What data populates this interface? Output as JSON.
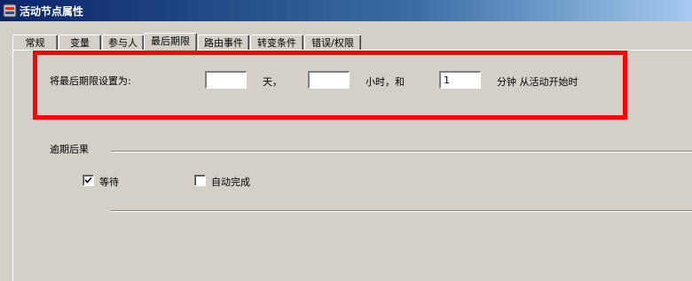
{
  "window": {
    "title": "活动节点属性"
  },
  "tabs": [
    {
      "label": "常规"
    },
    {
      "label": "变量"
    },
    {
      "label": "参与人"
    },
    {
      "label": "最后期限"
    },
    {
      "label": "路由事件"
    },
    {
      "label": "转变条件"
    },
    {
      "label": "错误/权限"
    }
  ],
  "active_tab": "最后期限",
  "deadline": {
    "label": "将最后期限设置为:",
    "days_value": "",
    "days_unit": "天，",
    "hours_value": "",
    "hours_unit": "小时，和",
    "minutes_value": "1",
    "minutes_unit": "分钟 从活动开始时"
  },
  "overdue": {
    "section_label": "逾期后果",
    "wait_label": "等待",
    "wait_checked": true,
    "auto_complete_label": "自动完成",
    "auto_complete_checked": false
  },
  "colors": {
    "highlight": "#ff0000",
    "titlebar_start": "#0a246a",
    "titlebar_end": "#a6caf0"
  }
}
